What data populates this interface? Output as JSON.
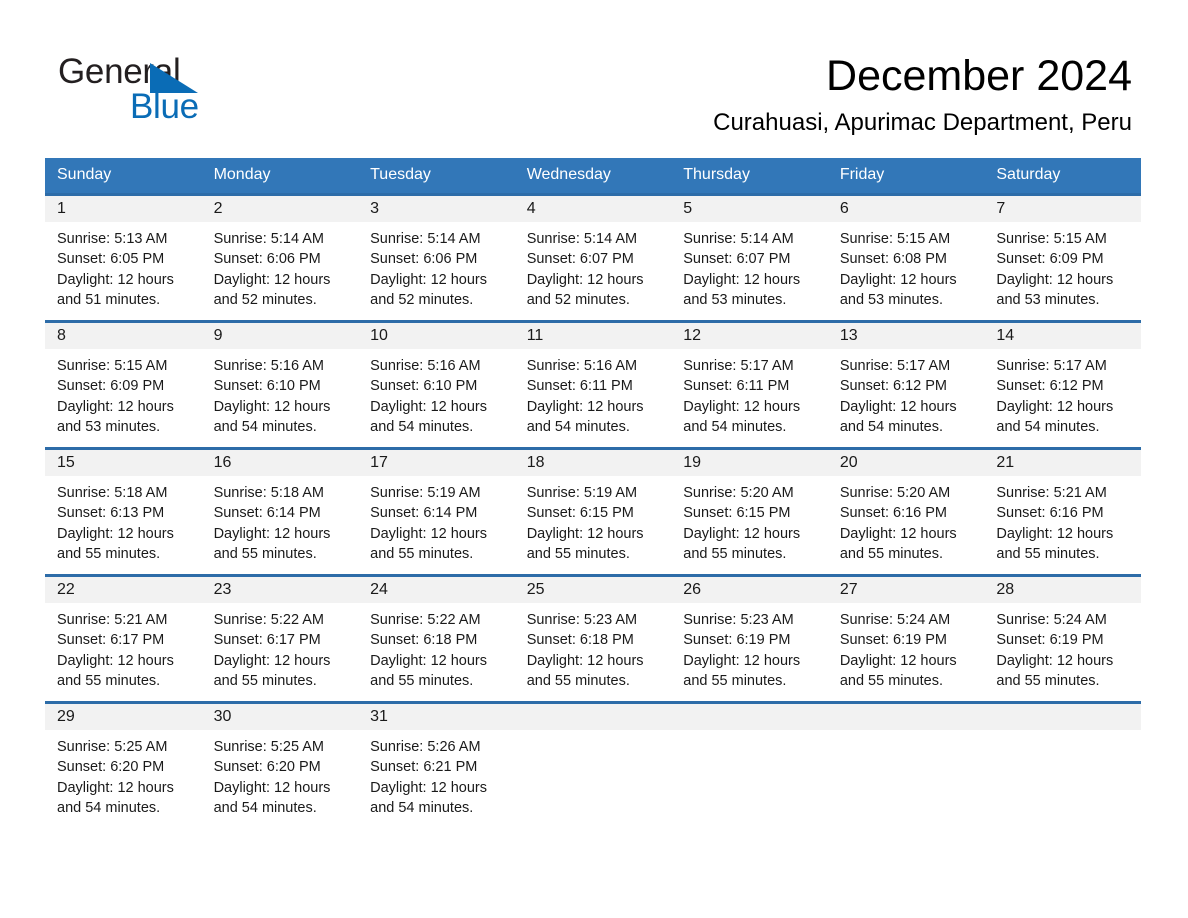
{
  "brand": {
    "name_part1": "General",
    "name_part2": "Blue",
    "triangle_color": "#0a6cb6"
  },
  "header": {
    "title": "December 2024",
    "subtitle": "Curahuasi, Apurimac Department, Peru"
  },
  "theme": {
    "header_blue": "#3277b8",
    "row_divider_blue": "#2d6ca8",
    "daynum_band_gray": "#f2f2f2"
  },
  "weekdays": [
    "Sunday",
    "Monday",
    "Tuesday",
    "Wednesday",
    "Thursday",
    "Friday",
    "Saturday"
  ],
  "weeks": [
    [
      {
        "day": "1",
        "sunrise": "Sunrise: 5:13 AM",
        "sunset": "Sunset: 6:05 PM",
        "daylight_line1": "Daylight: 12 hours",
        "daylight_line2": "and 51 minutes."
      },
      {
        "day": "2",
        "sunrise": "Sunrise: 5:14 AM",
        "sunset": "Sunset: 6:06 PM",
        "daylight_line1": "Daylight: 12 hours",
        "daylight_line2": "and 52 minutes."
      },
      {
        "day": "3",
        "sunrise": "Sunrise: 5:14 AM",
        "sunset": "Sunset: 6:06 PM",
        "daylight_line1": "Daylight: 12 hours",
        "daylight_line2": "and 52 minutes."
      },
      {
        "day": "4",
        "sunrise": "Sunrise: 5:14 AM",
        "sunset": "Sunset: 6:07 PM",
        "daylight_line1": "Daylight: 12 hours",
        "daylight_line2": "and 52 minutes."
      },
      {
        "day": "5",
        "sunrise": "Sunrise: 5:14 AM",
        "sunset": "Sunset: 6:07 PM",
        "daylight_line1": "Daylight: 12 hours",
        "daylight_line2": "and 53 minutes."
      },
      {
        "day": "6",
        "sunrise": "Sunrise: 5:15 AM",
        "sunset": "Sunset: 6:08 PM",
        "daylight_line1": "Daylight: 12 hours",
        "daylight_line2": "and 53 minutes."
      },
      {
        "day": "7",
        "sunrise": "Sunrise: 5:15 AM",
        "sunset": "Sunset: 6:09 PM",
        "daylight_line1": "Daylight: 12 hours",
        "daylight_line2": "and 53 minutes."
      }
    ],
    [
      {
        "day": "8",
        "sunrise": "Sunrise: 5:15 AM",
        "sunset": "Sunset: 6:09 PM",
        "daylight_line1": "Daylight: 12 hours",
        "daylight_line2": "and 53 minutes."
      },
      {
        "day": "9",
        "sunrise": "Sunrise: 5:16 AM",
        "sunset": "Sunset: 6:10 PM",
        "daylight_line1": "Daylight: 12 hours",
        "daylight_line2": "and 54 minutes."
      },
      {
        "day": "10",
        "sunrise": "Sunrise: 5:16 AM",
        "sunset": "Sunset: 6:10 PM",
        "daylight_line1": "Daylight: 12 hours",
        "daylight_line2": "and 54 minutes."
      },
      {
        "day": "11",
        "sunrise": "Sunrise: 5:16 AM",
        "sunset": "Sunset: 6:11 PM",
        "daylight_line1": "Daylight: 12 hours",
        "daylight_line2": "and 54 minutes."
      },
      {
        "day": "12",
        "sunrise": "Sunrise: 5:17 AM",
        "sunset": "Sunset: 6:11 PM",
        "daylight_line1": "Daylight: 12 hours",
        "daylight_line2": "and 54 minutes."
      },
      {
        "day": "13",
        "sunrise": "Sunrise: 5:17 AM",
        "sunset": "Sunset: 6:12 PM",
        "daylight_line1": "Daylight: 12 hours",
        "daylight_line2": "and 54 minutes."
      },
      {
        "day": "14",
        "sunrise": "Sunrise: 5:17 AM",
        "sunset": "Sunset: 6:12 PM",
        "daylight_line1": "Daylight: 12 hours",
        "daylight_line2": "and 54 minutes."
      }
    ],
    [
      {
        "day": "15",
        "sunrise": "Sunrise: 5:18 AM",
        "sunset": "Sunset: 6:13 PM",
        "daylight_line1": "Daylight: 12 hours",
        "daylight_line2": "and 55 minutes."
      },
      {
        "day": "16",
        "sunrise": "Sunrise: 5:18 AM",
        "sunset": "Sunset: 6:14 PM",
        "daylight_line1": "Daylight: 12 hours",
        "daylight_line2": "and 55 minutes."
      },
      {
        "day": "17",
        "sunrise": "Sunrise: 5:19 AM",
        "sunset": "Sunset: 6:14 PM",
        "daylight_line1": "Daylight: 12 hours",
        "daylight_line2": "and 55 minutes."
      },
      {
        "day": "18",
        "sunrise": "Sunrise: 5:19 AM",
        "sunset": "Sunset: 6:15 PM",
        "daylight_line1": "Daylight: 12 hours",
        "daylight_line2": "and 55 minutes."
      },
      {
        "day": "19",
        "sunrise": "Sunrise: 5:20 AM",
        "sunset": "Sunset: 6:15 PM",
        "daylight_line1": "Daylight: 12 hours",
        "daylight_line2": "and 55 minutes."
      },
      {
        "day": "20",
        "sunrise": "Sunrise: 5:20 AM",
        "sunset": "Sunset: 6:16 PM",
        "daylight_line1": "Daylight: 12 hours",
        "daylight_line2": "and 55 minutes."
      },
      {
        "day": "21",
        "sunrise": "Sunrise: 5:21 AM",
        "sunset": "Sunset: 6:16 PM",
        "daylight_line1": "Daylight: 12 hours",
        "daylight_line2": "and 55 minutes."
      }
    ],
    [
      {
        "day": "22",
        "sunrise": "Sunrise: 5:21 AM",
        "sunset": "Sunset: 6:17 PM",
        "daylight_line1": "Daylight: 12 hours",
        "daylight_line2": "and 55 minutes."
      },
      {
        "day": "23",
        "sunrise": "Sunrise: 5:22 AM",
        "sunset": "Sunset: 6:17 PM",
        "daylight_line1": "Daylight: 12 hours",
        "daylight_line2": "and 55 minutes."
      },
      {
        "day": "24",
        "sunrise": "Sunrise: 5:22 AM",
        "sunset": "Sunset: 6:18 PM",
        "daylight_line1": "Daylight: 12 hours",
        "daylight_line2": "and 55 minutes."
      },
      {
        "day": "25",
        "sunrise": "Sunrise: 5:23 AM",
        "sunset": "Sunset: 6:18 PM",
        "daylight_line1": "Daylight: 12 hours",
        "daylight_line2": "and 55 minutes."
      },
      {
        "day": "26",
        "sunrise": "Sunrise: 5:23 AM",
        "sunset": "Sunset: 6:19 PM",
        "daylight_line1": "Daylight: 12 hours",
        "daylight_line2": "and 55 minutes."
      },
      {
        "day": "27",
        "sunrise": "Sunrise: 5:24 AM",
        "sunset": "Sunset: 6:19 PM",
        "daylight_line1": "Daylight: 12 hours",
        "daylight_line2": "and 55 minutes."
      },
      {
        "day": "28",
        "sunrise": "Sunrise: 5:24 AM",
        "sunset": "Sunset: 6:19 PM",
        "daylight_line1": "Daylight: 12 hours",
        "daylight_line2": "and 55 minutes."
      }
    ],
    [
      {
        "day": "29",
        "sunrise": "Sunrise: 5:25 AM",
        "sunset": "Sunset: 6:20 PM",
        "daylight_line1": "Daylight: 12 hours",
        "daylight_line2": "and 54 minutes."
      },
      {
        "day": "30",
        "sunrise": "Sunrise: 5:25 AM",
        "sunset": "Sunset: 6:20 PM",
        "daylight_line1": "Daylight: 12 hours",
        "daylight_line2": "and 54 minutes."
      },
      {
        "day": "31",
        "sunrise": "Sunrise: 5:26 AM",
        "sunset": "Sunset: 6:21 PM",
        "daylight_line1": "Daylight: 12 hours",
        "daylight_line2": "and 54 minutes."
      },
      {
        "day": "",
        "sunrise": "",
        "sunset": "",
        "daylight_line1": "",
        "daylight_line2": ""
      },
      {
        "day": "",
        "sunrise": "",
        "sunset": "",
        "daylight_line1": "",
        "daylight_line2": ""
      },
      {
        "day": "",
        "sunrise": "",
        "sunset": "",
        "daylight_line1": "",
        "daylight_line2": ""
      },
      {
        "day": "",
        "sunrise": "",
        "sunset": "",
        "daylight_line1": "",
        "daylight_line2": ""
      }
    ]
  ]
}
